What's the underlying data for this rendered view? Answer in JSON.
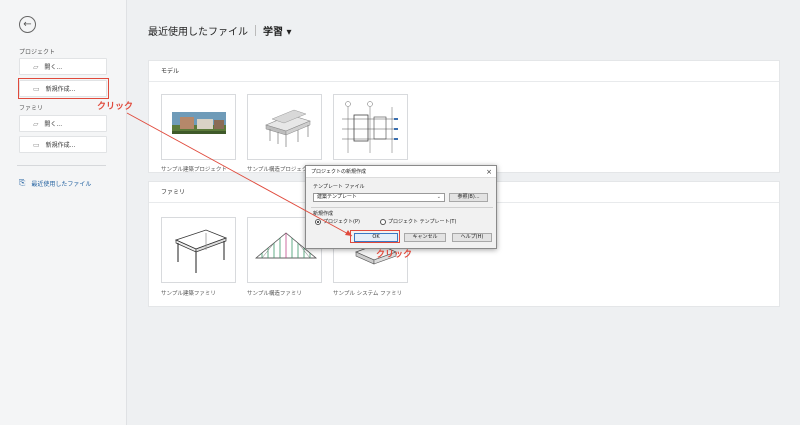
{
  "sidebar": {
    "section_project": "プロジェクト",
    "project_open": "開く...",
    "project_new": "新規作成...",
    "section_family": "ファミリ",
    "family_open": "開く...",
    "family_new": "新規作成...",
    "recent": "最近使用したファイル"
  },
  "header": {
    "title": "最近使用したファイル",
    "study": "学習 ▾"
  },
  "models": {
    "heading": "モデル",
    "tiles": [
      {
        "label": "サンプル建築プロジェクト"
      },
      {
        "label": "サンプル構造プロジェクト"
      },
      {
        "label": ""
      }
    ]
  },
  "families": {
    "heading": "ファミリ",
    "tiles": [
      {
        "label": "サンプル建築ファミリ"
      },
      {
        "label": "サンプル構造ファミリ"
      },
      {
        "label": "サンプル システム ファミリ"
      }
    ]
  },
  "dialog": {
    "title": "プロジェクトの新規作成",
    "template_label": "テンプレート ファイル",
    "template_value": "建築テンプレート",
    "browse": "参照(B)...",
    "create_label": "新規作成",
    "radio_project": "プロジェクト(P)",
    "radio_template": "プロジェクト テンプレート(T)",
    "ok": "OK",
    "cancel": "キャンセル",
    "help": "ヘルプ(H)"
  },
  "annotations": {
    "click1": "クリック",
    "click2": "クリック",
    "color": "#e04a3c"
  }
}
